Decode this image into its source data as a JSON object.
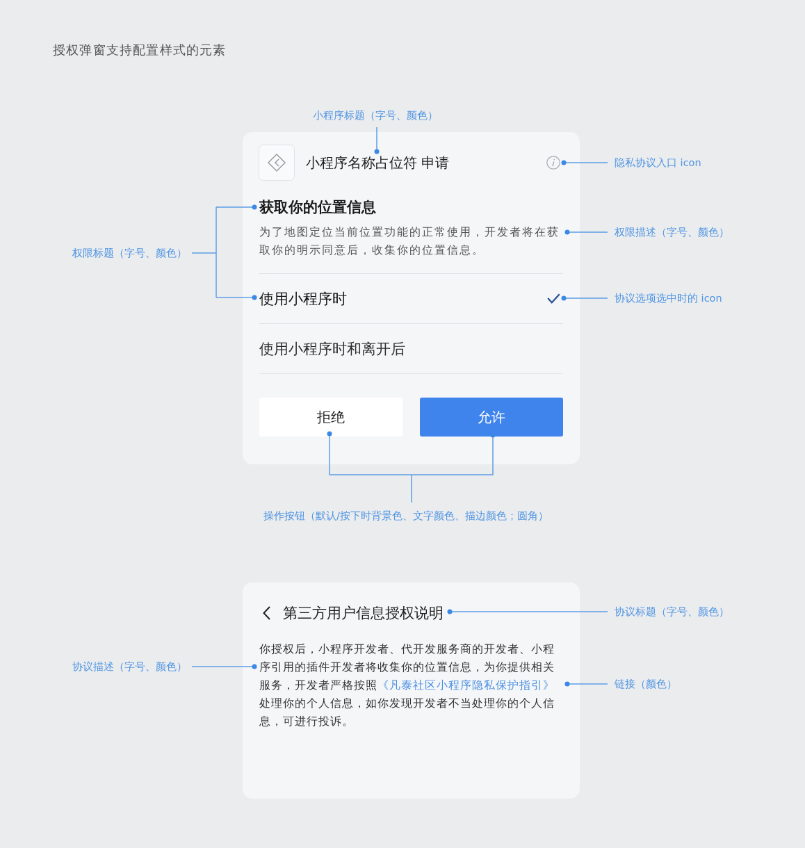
{
  "heading": "授权弹窗支持配置样式的元素",
  "auth_dialog": {
    "title": "小程序名称占位符 申请",
    "permission_title": "获取你的位置信息",
    "permission_description": "为了地图定位当前位置功能的正常使用，开发者将在获取你的明示同意后，收集你的位置信息。",
    "options": [
      {
        "label": "使用小程序时",
        "selected": true
      },
      {
        "label": "使用小程序时和离开后",
        "selected": false
      }
    ],
    "buttons": [
      {
        "label": "拒绝",
        "kind": "secondary"
      },
      {
        "label": "允许",
        "kind": "primary"
      }
    ]
  },
  "agreement_page": {
    "title": "第三方用户信息授权说明",
    "description": {
      "before": "你授权后，小程序开发者、代开发服务商的开发者、小程序引用的插件开发者将收集你的位置信息，为你提供相关服务，开发者严格按照",
      "link": "《凡泰社区小程序隐私保护指引》",
      "after": "处理你的个人信息，如你发现开发者不当处理你的个人信息，可进行投诉。"
    }
  },
  "annotations": [
    "小程序标题（字号、颜色）",
    "隐私协议入口 icon",
    "权限描述（字号、颜色）",
    "权限标题（字号、颜色）",
    "协议选项选中时的 icon",
    "操作按钮（默认/按下时背景色、文字颜色、描边颜色；圆角）",
    "协议标题（字号、颜色）",
    "协议描述（字号、颜色）",
    "链接（颜色）"
  ]
}
